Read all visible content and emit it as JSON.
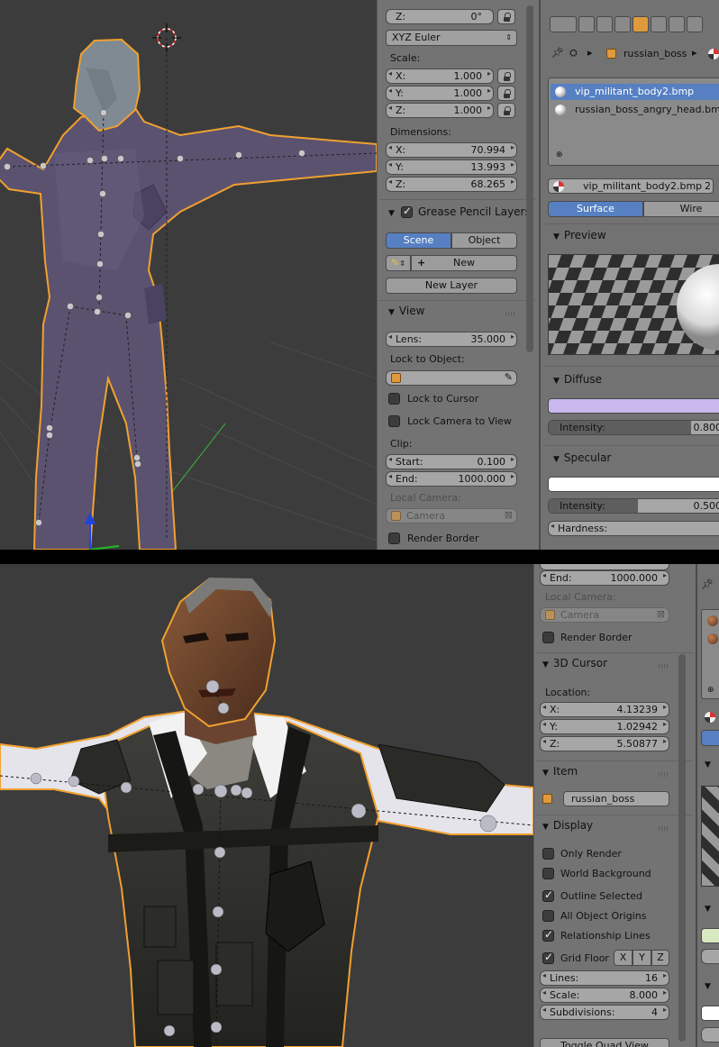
{
  "top": {
    "npanel": {
      "rotation_z": {
        "label": "Z:",
        "value": "0°"
      },
      "rotation_mode": "XYZ Euler",
      "scale_label": "Scale:",
      "scale": [
        {
          "label": "X:",
          "value": "1.000"
        },
        {
          "label": "Y:",
          "value": "1.000"
        },
        {
          "label": "Z:",
          "value": "1.000"
        }
      ],
      "dimensions_label": "Dimensions:",
      "dimensions": [
        {
          "label": "X:",
          "value": "70.994"
        },
        {
          "label": "Y:",
          "value": "13.993"
        },
        {
          "label": "Z:",
          "value": "68.265"
        }
      ],
      "grease_pencil_header": "Grease Pencil Layers",
      "gp_scene": "Scene",
      "gp_object": "Object",
      "gp_new": "New",
      "gp_new_layer": "New Layer",
      "view_header": "View",
      "lens": {
        "label": "Lens:",
        "value": "35.000"
      },
      "lock_to_object_label": "Lock to Object:",
      "lock_to_cursor": "Lock to Cursor",
      "lock_camera_to_view": "Lock Camera to View",
      "clip_label": "Clip:",
      "clip_start": {
        "label": "Start:",
        "value": "0.100"
      },
      "clip_end": {
        "label": "End:",
        "value": "1000.000"
      },
      "local_camera_label": "Local Camera:",
      "local_camera_value": "Camera",
      "render_border": "Render Border"
    },
    "props": {
      "breadcrumb_object": "russian_boss",
      "materials": [
        "vip_militant_body2.bmp",
        "russian_boss_angry_head.bmp"
      ],
      "material_name": "vip_militant_body2.bmp",
      "material_users": "2",
      "tab_surface": "Surface",
      "tab_wire": "Wire",
      "preview_header": "Preview",
      "diffuse_header": "Diffuse",
      "diffuse_color": "#c9b8ee",
      "diffuse_intensity": {
        "label": "Intensity:",
        "value": "0.800",
        "fraction": 0.8
      },
      "specular_header": "Specular",
      "specular_color": "#ffffff",
      "specular_intensity": {
        "label": "Intensity:",
        "value": "0.500",
        "fraction": 0.5
      },
      "hardness_label": "Hardness:"
    }
  },
  "bottom": {
    "npanel": {
      "clip_end": {
        "label": "End:",
        "value": "1000.000"
      },
      "local_camera_label": "Local Camera:",
      "local_camera_value": "Camera",
      "render_border": "Render Border",
      "cursor_header": "3D Cursor",
      "location_label": "Location:",
      "location": [
        {
          "label": "X:",
          "value": "4.13239"
        },
        {
          "label": "Y:",
          "value": "1.02942"
        },
        {
          "label": "Z:",
          "value": "5.50877"
        }
      ],
      "item_header": "Item",
      "item_name": "russian_boss",
      "display_header": "Display",
      "display_options": [
        {
          "label": "Only Render",
          "checked": false
        },
        {
          "label": "World Background",
          "checked": false
        },
        {
          "label": "Outline Selected",
          "checked": true
        },
        {
          "label": "All Object Origins",
          "checked": false
        },
        {
          "label": "Relationship Lines",
          "checked": true
        }
      ],
      "grid_floor": {
        "label": "Grid Floor",
        "checked": true
      },
      "grid_axes": [
        "X",
        "Y",
        "Z"
      ],
      "lines": {
        "label": "Lines:",
        "value": "16"
      },
      "scale": {
        "label": "Scale:",
        "value": "8.000"
      },
      "subdivisions": {
        "label": "Subdivisions:",
        "value": "4"
      },
      "toggle_quad_view": "Toggle Quad View"
    }
  },
  "colors": {
    "viewport_bg": "#3c3c3c",
    "panel_bg": "#737373",
    "accent_blue": "#5680c2",
    "selection_outline": "#f0a030"
  }
}
